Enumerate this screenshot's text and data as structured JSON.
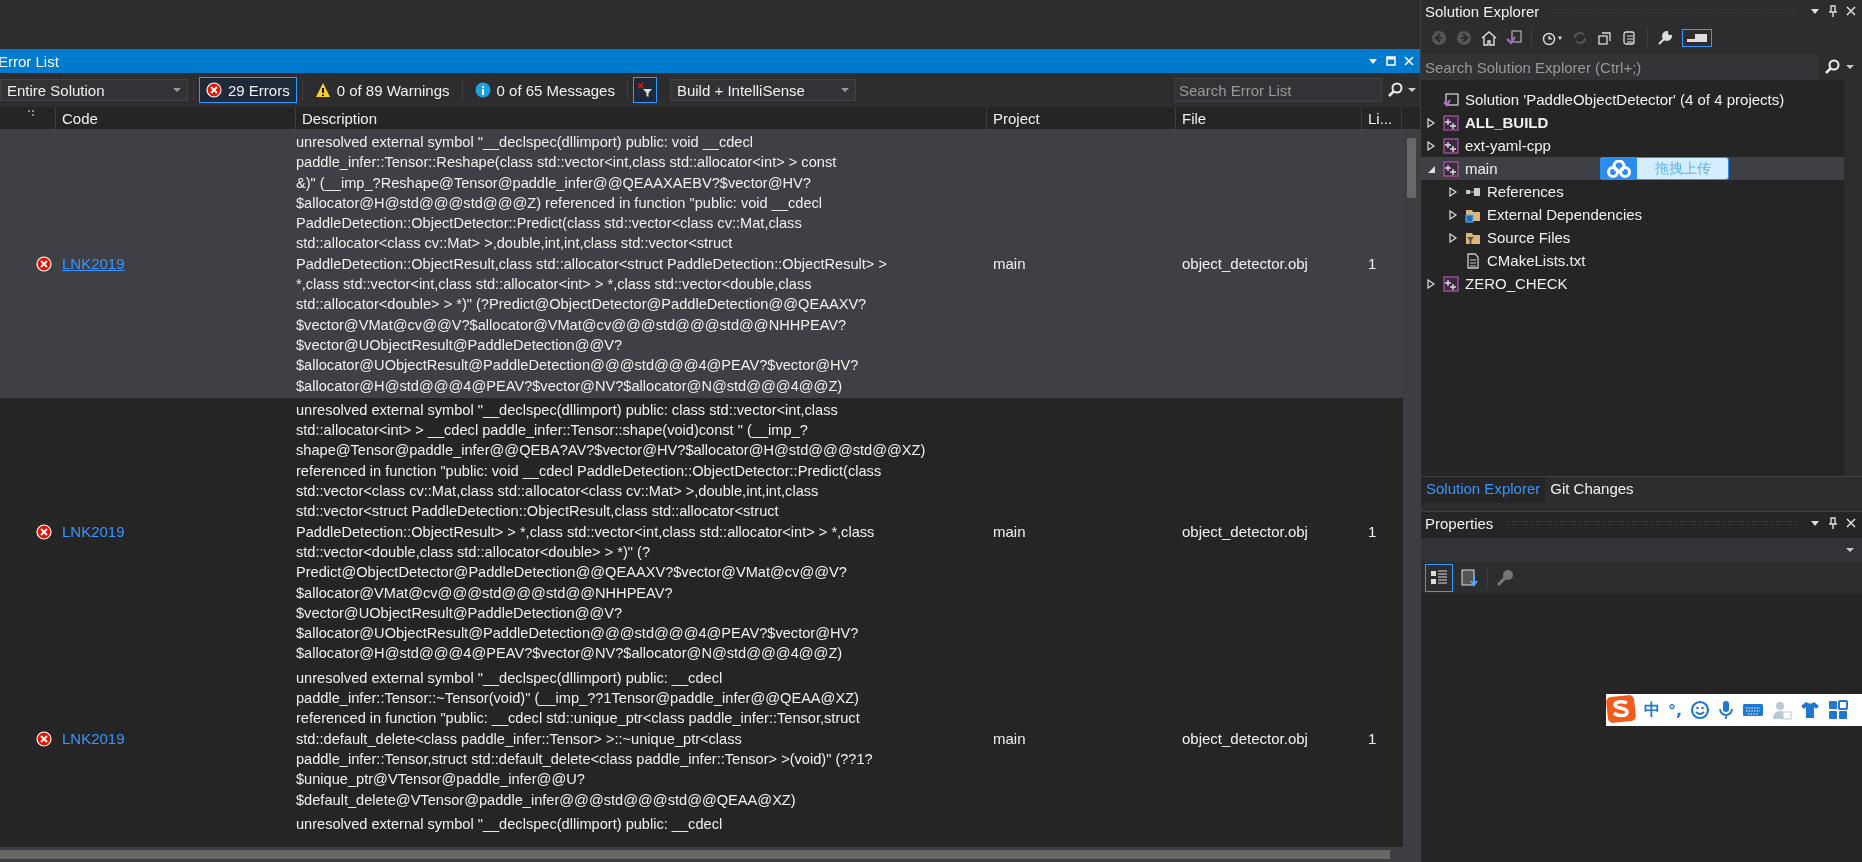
{
  "error_list": {
    "title": "Error List",
    "scope": "Entire Solution",
    "filters": [
      {
        "kind": "error",
        "label": "29 Errors",
        "selected": true
      },
      {
        "kind": "warning",
        "label": "0 of 89 Warnings",
        "selected": false
      },
      {
        "kind": "message",
        "label": "0 of 65 Messages",
        "selected": false
      }
    ],
    "source": "Build + IntelliSense",
    "search": {
      "placeholder": "Search Error List"
    },
    "columns": [
      "Code",
      "Description",
      "Project",
      "File",
      "Li..."
    ],
    "rows": [
      {
        "code": "LNK2019",
        "description": "unresolved external symbol \"__declspec(dllimport) public: void __cdecl\npaddle_infer::Tensor::Reshape(class std::vector<int,class std::allocator<int> > const\n&)\" (__imp_?Reshape@Tensor@paddle_infer@@QEAAXAEBV?$vector@HV?\n$allocator@H@std@@@std@@@Z) referenced in function \"public: void __cdecl\nPaddleDetection::ObjectDetector::Predict(class std::vector<class cv::Mat,class\nstd::allocator<class cv::Mat> >,double,int,int,class std::vector<struct\nPaddleDetection::ObjectResult,class std::allocator<struct PaddleDetection::ObjectResult> >\n*,class std::vector<int,class std::allocator<int> > *,class std::vector<double,class\nstd::allocator<double> > *)\" (?Predict@ObjectDetector@PaddleDetection@@QEAAXV?\n$vector@VMat@cv@@V?$allocator@VMat@cv@@@std@@@std@@NHHPEAV?\n$vector@UObjectResult@PaddleDetection@@V?\n$allocator@UObjectResult@PaddleDetection@@@std@@@4@PEAV?$vector@HV?\n$allocator@H@std@@@4@PEAV?$vector@NV?$allocator@N@std@@@4@@Z)",
        "project": "main",
        "file": "object_detector.obj",
        "line": "1",
        "selected": true
      },
      {
        "code": "LNK2019",
        "description": "unresolved external symbol \"__declspec(dllimport) public: class std::vector<int,class\nstd::allocator<int> > __cdecl paddle_infer::Tensor::shape(void)const \" (__imp_?\nshape@Tensor@paddle_infer@@QEBA?AV?$vector@HV?$allocator@H@std@@@std@@XZ)\nreferenced in function \"public: void __cdecl PaddleDetection::ObjectDetector::Predict(class\nstd::vector<class cv::Mat,class std::allocator<class cv::Mat> >,double,int,int,class\nstd::vector<struct PaddleDetection::ObjectResult,class std::allocator<struct\nPaddleDetection::ObjectResult> > *,class std::vector<int,class std::allocator<int> > *,class\nstd::vector<double,class std::allocator<double> > *)\" (?\nPredict@ObjectDetector@PaddleDetection@@QEAAXV?$vector@VMat@cv@@V?\n$allocator@VMat@cv@@@std@@@std@@NHHPEAV?\n$vector@UObjectResult@PaddleDetection@@V?\n$allocator@UObjectResult@PaddleDetection@@@std@@@4@PEAV?$vector@HV?\n$allocator@H@std@@@4@PEAV?$vector@NV?$allocator@N@std@@@4@@Z)",
        "project": "main",
        "file": "object_detector.obj",
        "line": "1",
        "selected": false
      },
      {
        "code": "LNK2019",
        "description": "unresolved external symbol \"__declspec(dllimport) public: __cdecl\npaddle_infer::Tensor::~Tensor(void)\" (__imp_??1Tensor@paddle_infer@@QEAA@XZ)\nreferenced in function \"public: __cdecl std::unique_ptr<class paddle_infer::Tensor,struct\nstd::default_delete<class paddle_infer::Tensor> >::~unique_ptr<class\npaddle_infer::Tensor,struct std::default_delete<class paddle_infer::Tensor> >(void)\" (??1?\n$unique_ptr@VTensor@paddle_infer@@U?\n$default_delete@VTensor@paddle_infer@@@std@@@std@@QEAA@XZ)",
        "project": "main",
        "file": "object_detector.obj",
        "line": "1",
        "selected": false
      },
      {
        "description": "unresolved external symbol \"__declspec(dllimport) public: __cdecl",
        "selected": false
      }
    ]
  },
  "solution_explorer": {
    "title": "Solution Explorer",
    "search": {
      "placeholder": "Search Solution Explorer (Ctrl+;)"
    },
    "tree": [
      {
        "label": "Solution 'PaddleObjectDetector' (4 of 4 projects)",
        "kind": "solution",
        "children": [
          {
            "label": "ALL_BUILD",
            "kind": "project",
            "startup": true,
            "expanded": false,
            "selected": false
          },
          {
            "label": "ext-yaml-cpp",
            "kind": "project",
            "startup": false,
            "expanded": false,
            "selected": false
          },
          {
            "label": "main",
            "kind": "project",
            "startup": false,
            "expanded": true,
            "selected": true,
            "children": [
              {
                "label": "References",
                "kind": "references",
                "expanded": false,
                "selected": false
              },
              {
                "label": "External Dependencies",
                "kind": "external",
                "expanded": false,
                "selected": false
              },
              {
                "label": "Source Files",
                "kind": "filter",
                "expanded": false,
                "selected": false
              },
              {
                "label": "CMakeLists.txt",
                "kind": "file",
                "selected": false
              }
            ]
          },
          {
            "label": "ZERO_CHECK",
            "kind": "project",
            "startup": false,
            "expanded": false,
            "selected": false
          }
        ]
      }
    ],
    "tabs": [
      {
        "label": "Solution Explorer",
        "selected": true
      },
      {
        "label": "Git Changes",
        "selected": false
      }
    ]
  },
  "upload_badge": {
    "label": "拖拽上传"
  },
  "properties": {
    "title": "Properties"
  },
  "ime_toolbar": {
    "mode": "中",
    "punctuation": "°,"
  }
}
